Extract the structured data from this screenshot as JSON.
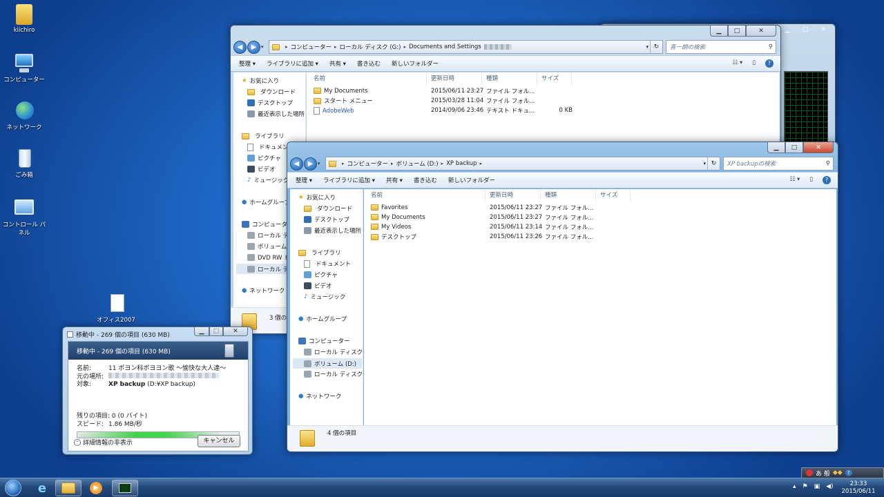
{
  "desktop": {
    "icons": [
      {
        "label": "kiichiro"
      },
      {
        "label": "コンピューター"
      },
      {
        "label": "ネットワーク"
      },
      {
        "label": "ごみ箱"
      },
      {
        "label": "コントロール パネル"
      },
      {
        "label": "オフィス2007"
      }
    ]
  },
  "explorer_back": {
    "breadcrumb": [
      "コンピューター",
      "ローカル ディスク (G:)",
      "Documents and Settings"
    ],
    "search_placeholder": "喜一朗の検索",
    "toolbar": [
      "整理 ▾",
      "ライブラリに追加 ▾",
      "共有 ▾",
      "書き込む",
      "新しいフォルダー"
    ],
    "columns": [
      "名前",
      "更新日時",
      "種類",
      "サイズ"
    ],
    "files": [
      {
        "name": "My Documents",
        "date": "2015/06/11 23:27",
        "type": "ファイル フォル...",
        "size": ""
      },
      {
        "name": "スタート メニュー",
        "date": "2015/03/28 11:04",
        "type": "ファイル フォル...",
        "size": ""
      },
      {
        "name": "AdobeWeb",
        "date": "2014/09/06 23:46",
        "type": "テキスト ドキュ...",
        "size": "0 KB"
      }
    ],
    "nav": [
      "お気に入り",
      "ダウンロード",
      "デスクトップ",
      "最近表示した場所",
      "ライブラリ",
      "ドキュメント",
      "ピクチャ",
      "ビデオ",
      "ミュージック",
      "ホームグループ",
      "コンピューター",
      "ローカル ディ",
      "ボリューム (",
      "DVD RW ド",
      "ローカル ディ",
      "ネットワーク"
    ],
    "status": "3 個の"
  },
  "explorer_front": {
    "breadcrumb": [
      "コンピューター",
      "ボリューム (D:)",
      "XP backup"
    ],
    "search_placeholder": "XP backupの検索",
    "toolbar": [
      "整理 ▾",
      "ライブラリに追加 ▾",
      "共有 ▾",
      "書き込む",
      "新しいフォルダー"
    ],
    "columns": [
      "名前",
      "更新日時",
      "種類",
      "サイズ"
    ],
    "files": [
      {
        "name": "Favorites",
        "date": "2015/06/11 23:27",
        "type": "ファイル フォル..."
      },
      {
        "name": "My Documents",
        "date": "2015/06/11 23:27",
        "type": "ファイル フォル..."
      },
      {
        "name": "My Videos",
        "date": "2015/06/11 23:14",
        "type": "ファイル フォル..."
      },
      {
        "name": "デスクトップ",
        "date": "2015/06/11 23:26",
        "type": "ファイル フォル..."
      }
    ],
    "nav": [
      "お気に入り",
      "ダウンロード",
      "デスクトップ",
      "最近表示した場所",
      "ライブラリ",
      "ドキュメント",
      "ピクチャ",
      "ビデオ",
      "ミュージック",
      "ホームグループ",
      "コンピューター",
      "ローカル ディスク (",
      "ボリューム (D:)",
      "ローカル ディスク (",
      "ネットワーク"
    ],
    "status": "4 個の項目"
  },
  "copy_dialog": {
    "title": "移動中 - 269 個の項目 (630 MB)",
    "header": "移動中 - 269 個の項目 (630 MB)",
    "name_label": "名前:",
    "name_value": "11 ポヨン科ポヨヨン歌 〜愉快な大人達〜",
    "from_label": "元の場所:",
    "to_label": "対象:",
    "to_value_bold": "XP backup",
    "to_value": " (D:¥XP backup)",
    "remaining_label": "残りの項目:",
    "remaining_value": "0 (0 バイト)",
    "speed_label": "スピード:",
    "speed_value": "1.86 MB/秒",
    "progress": 0.9,
    "details_toggle": "詳細情報の非表示",
    "cancel": "キャンセル"
  },
  "taskbar": {
    "clock_time": "23:33",
    "clock_date": "2015/06/11",
    "ime": "あ 般"
  },
  "colors": {
    "progress": "#3fd34a",
    "selection": "#dde8f5"
  }
}
